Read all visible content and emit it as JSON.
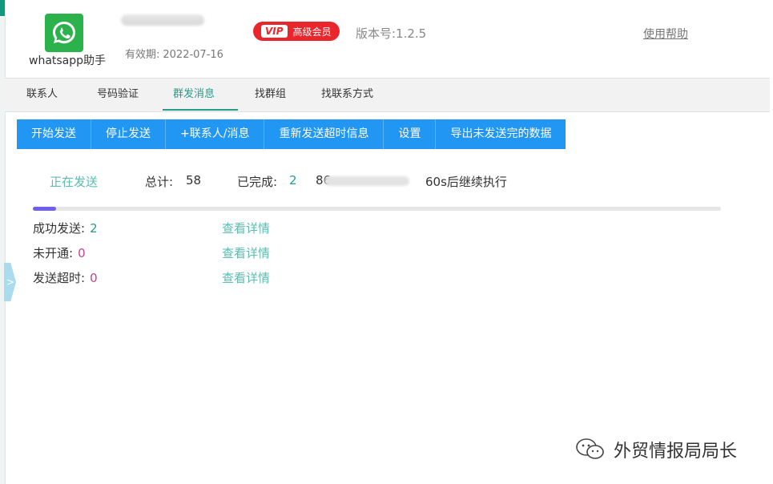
{
  "header": {
    "app_name": "whatsapp助手",
    "validity_label": "有效期:",
    "validity_date": "2022-07-16",
    "vip_tag": "VIP",
    "vip_label": "高级会员",
    "version": "版本号:1.2.5",
    "help": "使用帮助"
  },
  "tabs": [
    {
      "label": "联系人"
    },
    {
      "label": "号码验证"
    },
    {
      "label": "群发消息",
      "active": true
    },
    {
      "label": "找群组"
    },
    {
      "label": "找联系方式"
    }
  ],
  "toolbar": {
    "start": "开始发送",
    "stop": "停止发送",
    "add_contact": "+联系人/消息",
    "resend": "重新发送超时信息",
    "settings": "设置",
    "export": "导出未发送完的数据"
  },
  "status": {
    "sending": "正在发送",
    "total_label": "总计:",
    "total_value": "58",
    "done_label": "已完成:",
    "done_value": "2",
    "phone_prefix": "86",
    "timer": "60s后继续执行",
    "progress_fraction": 0.034
  },
  "stats": [
    {
      "label": "成功发送:",
      "value": "2",
      "link": "查看详情"
    },
    {
      "label": "未开通:",
      "value": "0",
      "link": "查看详情"
    },
    {
      "label": "发送超时:",
      "value": "0",
      "link": "查看详情"
    }
  ],
  "side_toggle": ">",
  "watermark": "外贸情报局局长",
  "colors": {
    "accent": "#2a9a8a",
    "button": "#2196f3",
    "vip": "#e8262c",
    "progress": "#6e5ff0",
    "pink_value": "#c2448f"
  }
}
